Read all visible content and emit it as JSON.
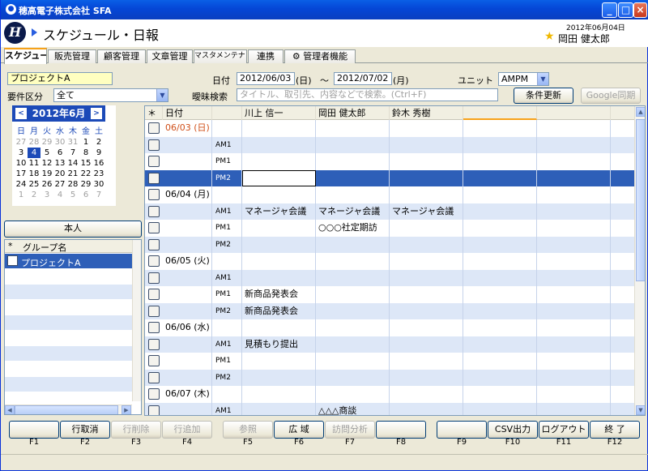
{
  "window": {
    "title": "穂高電子株式会社 SFA",
    "logo_glyph": "H"
  },
  "header": {
    "page_title": "スケジュール・日報",
    "date": "2012年06月04日",
    "user": "岡田 健太郎"
  },
  "tabs": [
    "スケジュール",
    "販売管理",
    "顧客管理",
    "文章管理",
    "マスタメンテナンス",
    "連携",
    "管理者機能"
  ],
  "form": {
    "project_value": "プロジェクトA",
    "requirement_label": "要件区分",
    "requirement_value": "全て",
    "date_label": "日付",
    "date_from": "2012/06/03",
    "date_from_dow": "(日)",
    "tilde": "～",
    "date_to": "2012/07/02",
    "date_to_dow": "(月)",
    "unit_label": "ユニット",
    "unit_value": "AMPM",
    "fuzzy_label": "曖昧検索",
    "fuzzy_placeholder": "タイトル、取引先、内容などで検索。(Ctrl+F)",
    "update_button": "条件更新",
    "google_button": "Google同期"
  },
  "calendar": {
    "title": "2012年6月",
    "prev": "<",
    "next": ">",
    "weekdays": [
      "日",
      "月",
      "火",
      "水",
      "木",
      "金",
      "土"
    ],
    "weeks": [
      [
        "27",
        "28",
        "29",
        "30",
        "31",
        "1",
        "2"
      ],
      [
        "3",
        "4",
        "5",
        "6",
        "7",
        "8",
        "9"
      ],
      [
        "10",
        "11",
        "12",
        "13",
        "14",
        "15",
        "16"
      ],
      [
        "17",
        "18",
        "19",
        "20",
        "21",
        "22",
        "23"
      ],
      [
        "24",
        "25",
        "26",
        "27",
        "28",
        "29",
        "30"
      ],
      [
        "1",
        "2",
        "3",
        "4",
        "5",
        "6",
        "7"
      ]
    ]
  },
  "group_panel": {
    "self_button": "本人",
    "header": "グループ名",
    "items": [
      "プロジェクトA"
    ]
  },
  "grid": {
    "headers": [
      "＊",
      "日付",
      "",
      "川上 信一",
      "岡田 健太郎",
      "鈴木 秀樹",
      "",
      ""
    ],
    "rows": [
      {
        "date": "06/03 (日)",
        "unit": "",
        "c1": "",
        "c2": "",
        "c3": ""
      },
      {
        "date": "",
        "unit": "AM1",
        "c1": "",
        "c2": "",
        "c3": ""
      },
      {
        "date": "",
        "unit": "PM1",
        "c1": "",
        "c2": "",
        "c3": ""
      },
      {
        "date": "",
        "unit": "PM2",
        "c1": "",
        "c2": "",
        "c3": ""
      },
      {
        "date": "06/04 (月)",
        "unit": "",
        "c1": "",
        "c2": "",
        "c3": ""
      },
      {
        "date": "",
        "unit": "AM1",
        "c1": "マネージャ会議",
        "c2": "マネージャ会議",
        "c3": "マネージャ会議"
      },
      {
        "date": "",
        "unit": "PM1",
        "c1": "",
        "c2": "○○○社定期訪",
        "c3": ""
      },
      {
        "date": "",
        "unit": "PM2",
        "c1": "",
        "c2": "",
        "c3": ""
      },
      {
        "date": "06/05 (火)",
        "unit": "",
        "c1": "",
        "c2": "",
        "c3": ""
      },
      {
        "date": "",
        "unit": "AM1",
        "c1": "",
        "c2": "",
        "c3": ""
      },
      {
        "date": "",
        "unit": "PM1",
        "c1": "新商品発表会",
        "c2": "",
        "c3": ""
      },
      {
        "date": "",
        "unit": "PM2",
        "c1": "新商品発表会",
        "c2": "",
        "c3": ""
      },
      {
        "date": "06/06 (水)",
        "unit": "",
        "c1": "",
        "c2": "",
        "c3": ""
      },
      {
        "date": "",
        "unit": "AM1",
        "c1": "見積もり提出",
        "c2": "",
        "c3": ""
      },
      {
        "date": "",
        "unit": "PM1",
        "c1": "",
        "c2": "",
        "c3": ""
      },
      {
        "date": "",
        "unit": "PM2",
        "c1": "",
        "c2": "",
        "c3": ""
      },
      {
        "date": "06/07 (木)",
        "unit": "",
        "c1": "",
        "c2": "",
        "c3": ""
      },
      {
        "date": "",
        "unit": "AM1",
        "c1": "",
        "c2": "△△△商談",
        "c3": ""
      }
    ]
  },
  "fkeys": [
    {
      "label": "",
      "key": "F1"
    },
    {
      "label": "行取消",
      "key": "F2"
    },
    {
      "label": "行削除",
      "key": "F3"
    },
    {
      "label": "行追加",
      "key": "F4"
    },
    {
      "label": "参照",
      "key": "F5"
    },
    {
      "label": "広 域",
      "key": "F6"
    },
    {
      "label": "訪問分析",
      "key": "F7"
    },
    {
      "label": "",
      "key": "F8"
    },
    {
      "label": "",
      "key": "F9"
    },
    {
      "label": "CSV出力",
      "key": "F10"
    },
    {
      "label": "ログアウト",
      "key": "F11"
    },
    {
      "label": "終 了",
      "key": "F12"
    }
  ]
}
